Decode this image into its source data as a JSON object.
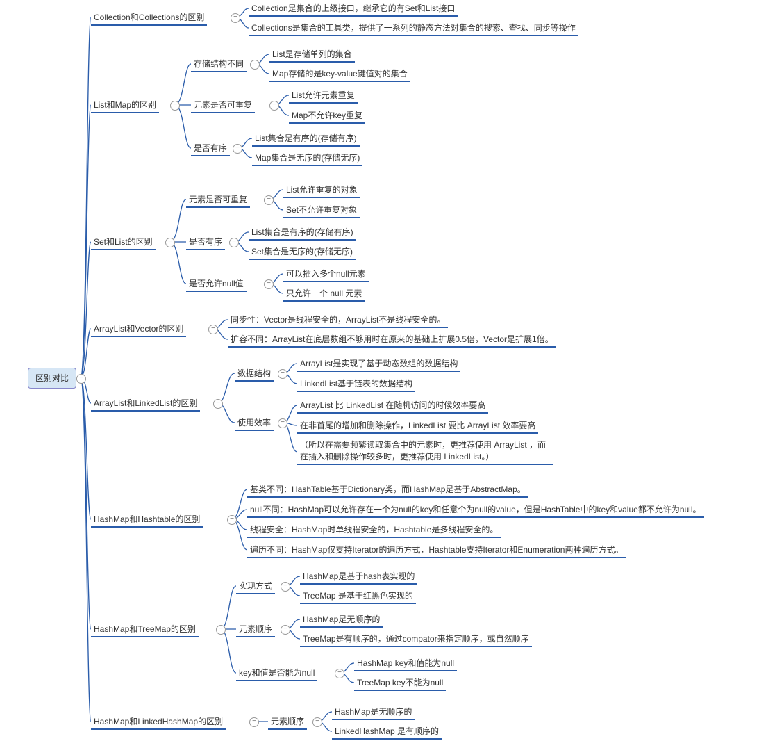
{
  "root": "区别对比",
  "b1": {
    "t": "Collection和Collections的区别",
    "c": [
      "Collection是集合的上级接口，继承它的有Set和List接口",
      "Collections是集合的工具类，提供了一系列的静态方法对集合的搜索、查找、同步等操作"
    ]
  },
  "b2": {
    "t": "List和Map的区别",
    "s1": {
      "t": "存储结构不同",
      "c": [
        "List是存储单列的集合",
        "Map存储的是key-value键值对的集合"
      ]
    },
    "s2": {
      "t": "元素是否可重复",
      "c": [
        "List允许元素重复",
        "Map不允许key重复"
      ]
    },
    "s3": {
      "t": "是否有序",
      "c": [
        "List集合是有序的(存储有序)",
        "Map集合是无序的(存储无序)"
      ]
    }
  },
  "b3": {
    "t": "Set和List的区别",
    "s1": {
      "t": "元素是否可重复",
      "c": [
        "List允许重复的对象",
        "Set不允许重复对象"
      ]
    },
    "s2": {
      "t": "是否有序",
      "c": [
        "List集合是有序的(存储有序)",
        "Set集合是无序的(存储无序)"
      ]
    },
    "s3": {
      "t": "是否允许null值",
      "c": [
        "可以插入多个null元素",
        "只允许一个 null 元素"
      ]
    }
  },
  "b4": {
    "t": "ArrayList和Vector的区别",
    "c": [
      "同步性：Vector是线程安全的，ArrayList不是线程安全的。",
      "扩容不同：ArrayList在底层数组不够用时在原来的基础上扩展0.5倍，Vector是扩展1倍。"
    ]
  },
  "b5": {
    "t": "ArrayList和LinkedList的区别",
    "s1": {
      "t": "数据结构",
      "c": [
        "ArrayList是实现了基于动态数组的数据结构",
        "LinkedList基于链表的数据结构"
      ]
    },
    "s2": {
      "t": "使用效率",
      "c": [
        "ArrayList 比 LinkedList 在随机访问的时候效率要高",
        "在非首尾的增加和删除操作，LinkedList 要比 ArrayList 效率要高",
        "（所以在需要频繁读取集合中的元素时，更推荐使用 ArrayList ，而在插入和删除操作较多时，更推荐使用 LinkedList。）"
      ]
    }
  },
  "b6": {
    "t": "HashMap和Hashtable的区别",
    "c": [
      "基类不同：HashTable基于Dictionary类，而HashMap是基于AbstractMap。",
      "null不同：HashMap可以允许存在一个为null的key和任意个为null的value，但是HashTable中的key和value都不允许为null。",
      "线程安全：HashMap时单线程安全的，Hashtable是多线程安全的。",
      "遍历不同：HashMap仅支持Iterator的遍历方式，Hashtable支持Iterator和Enumeration两种遍历方式。"
    ]
  },
  "b7": {
    "t": "HashMap和TreeMap的区别",
    "s1": {
      "t": "实现方式",
      "c": [
        "HashMap是基于hash表实现的",
        "TreeMap 是基于红黑色实现的"
      ]
    },
    "s2": {
      "t": "元素顺序",
      "c": [
        "HashMap是无顺序的",
        "TreeMap是有顺序的，通过compator来指定顺序，或自然顺序"
      ]
    },
    "s3": {
      "t": "key和值是否能为null",
      "c": [
        "HashMap key和值能为null",
        "TreeMap key不能为null"
      ]
    }
  },
  "b8": {
    "t": "HashMap和LinkedHashMap的区别",
    "s1": {
      "t": "元素顺序",
      "c": [
        "HashMap是无顺序的",
        "LinkedHashMap 是有顺序的"
      ]
    }
  }
}
